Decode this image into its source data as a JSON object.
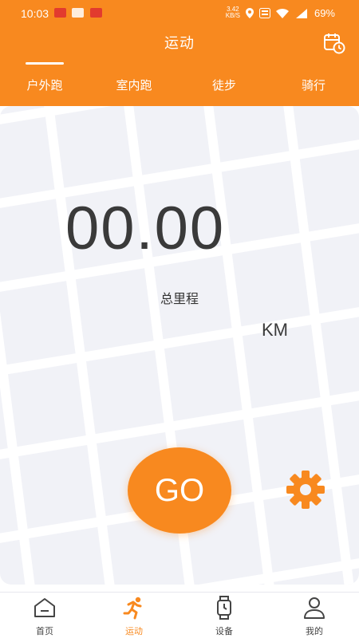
{
  "status_bar": {
    "time": "10:03",
    "network_speed_value": "3.42",
    "network_speed_unit": "KB/S",
    "battery": "69%"
  },
  "header": {
    "title": "运动",
    "history_icon": "calendar-clock-icon"
  },
  "tabs": [
    {
      "label": "户外跑",
      "active": true
    },
    {
      "label": "室内跑",
      "active": false
    },
    {
      "label": "徒步",
      "active": false
    },
    {
      "label": "骑行",
      "active": false
    }
  ],
  "main": {
    "distance_value": "00.00",
    "distance_unit": "KM",
    "distance_label": "总里程",
    "go_label": "GO",
    "settings_icon": "gear-icon"
  },
  "bottom_nav": [
    {
      "label": "首页",
      "icon": "home-icon",
      "active": false
    },
    {
      "label": "运动",
      "icon": "running-icon",
      "active": true
    },
    {
      "label": "设备",
      "icon": "watch-icon",
      "active": false
    },
    {
      "label": "我的",
      "icon": "user-icon",
      "active": false
    }
  ],
  "colors": {
    "accent": "#f8891f",
    "map_background": "#f1f2f7",
    "map_roads": "#ffffff"
  }
}
